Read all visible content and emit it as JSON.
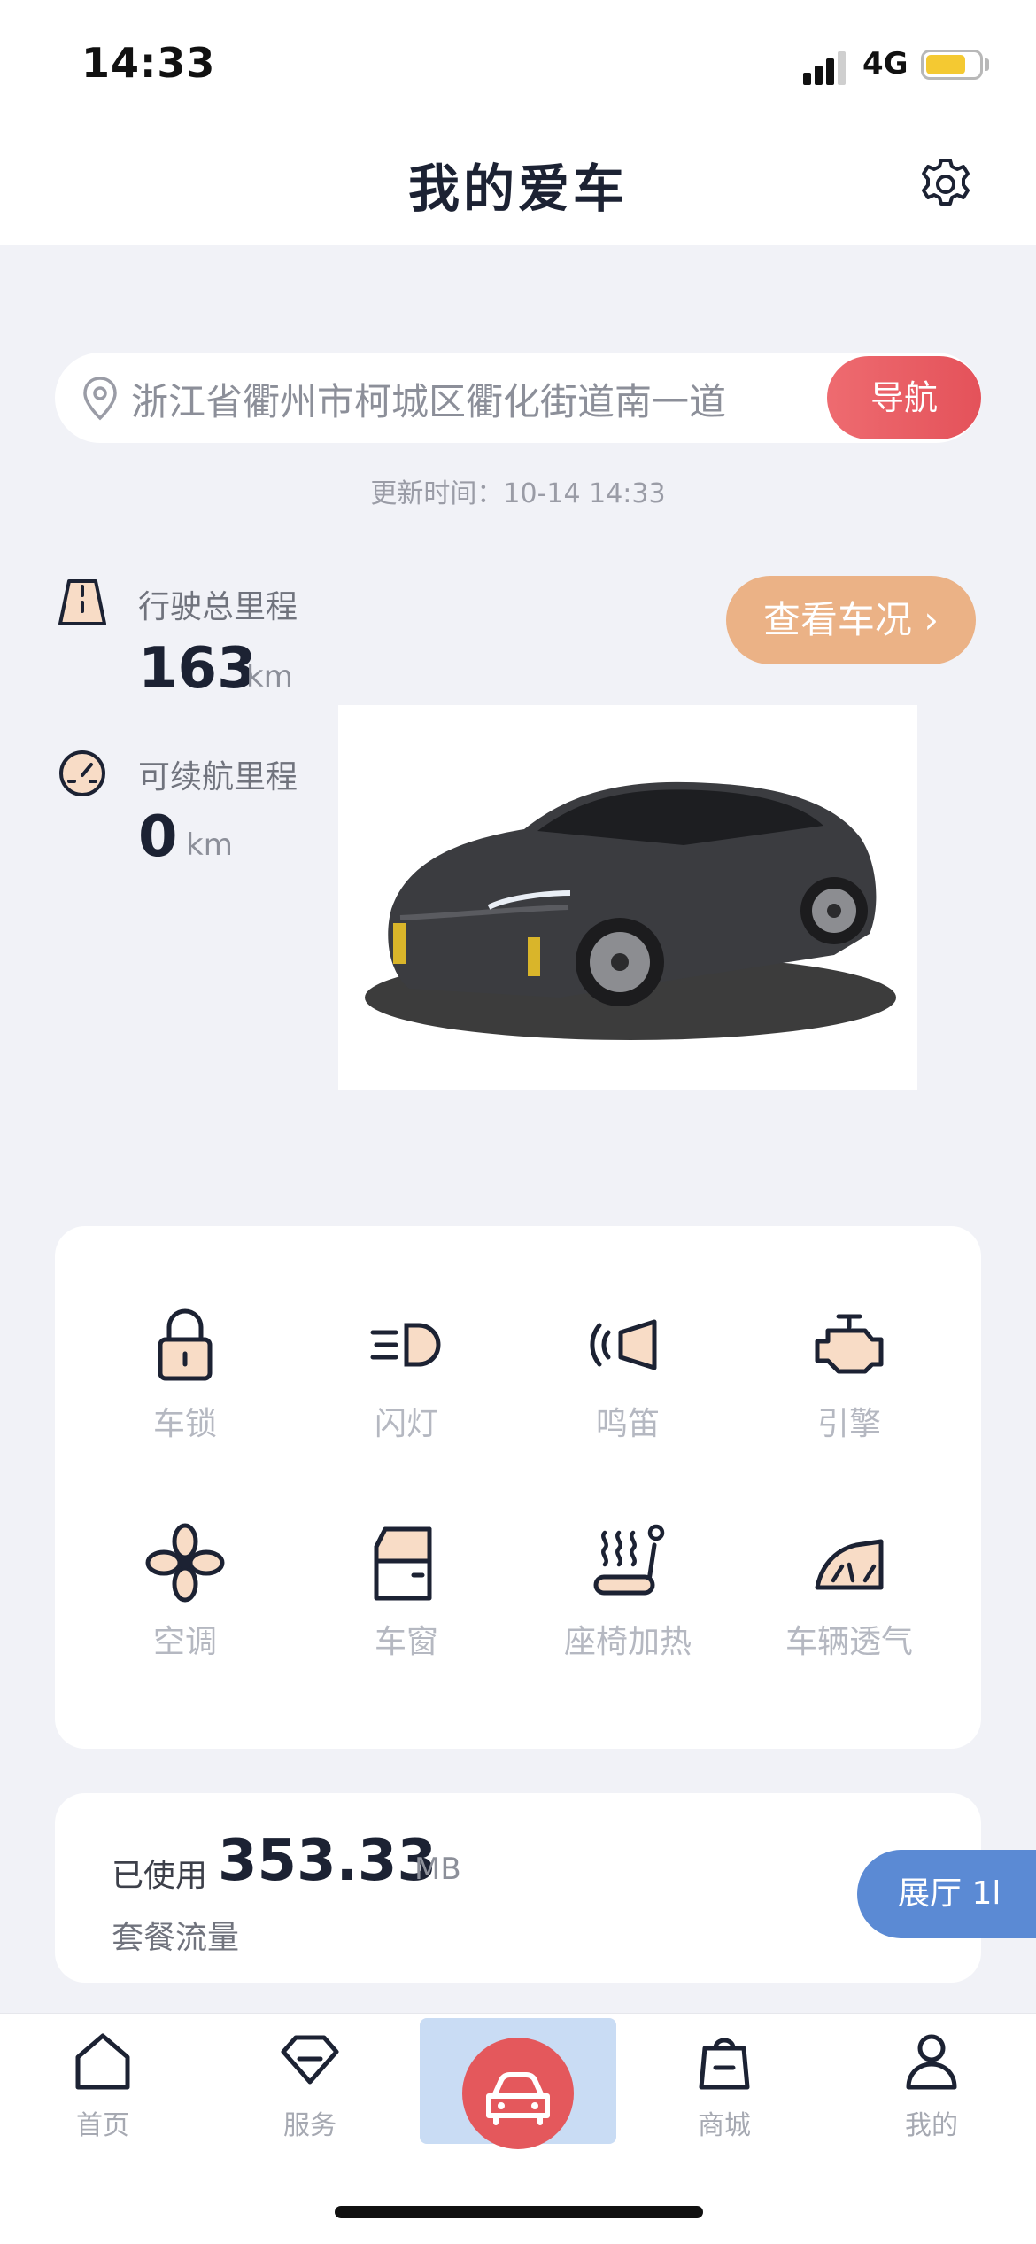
{
  "status_bar": {
    "time": "14:33",
    "network": "4G"
  },
  "header": {
    "title": "我的爱车",
    "settings_icon": "gear-icon"
  },
  "location": {
    "address": "浙江省衢州市柯城区衢化街道南一道",
    "nav_button": "导航",
    "updated": "更新时间：10-14 14:33"
  },
  "stats": {
    "total_label": "行驶总里程",
    "total_value": "163",
    "total_unit": "km",
    "range_label": "可续航里程",
    "range_value": "0",
    "range_unit": "km",
    "status_button": "查看车况 ›"
  },
  "controls": [
    {
      "label": "车锁",
      "icon": "lock-icon"
    },
    {
      "label": "闪灯",
      "icon": "headlight-icon"
    },
    {
      "label": "鸣笛",
      "icon": "horn-icon"
    },
    {
      "label": "引擎",
      "icon": "engine-icon"
    },
    {
      "label": "空调",
      "icon": "fan-icon"
    },
    {
      "label": "车窗",
      "icon": "window-icon"
    },
    {
      "label": "座椅加热",
      "icon": "seat-heat-icon"
    },
    {
      "label": "车辆透气",
      "icon": "vent-icon"
    }
  ],
  "data_usage": {
    "used_label": "已使用",
    "value": "353.33",
    "unit": "MB",
    "caption": "套餐流量",
    "showroom_button": "展厅 1l"
  },
  "tabs": [
    {
      "label": "首页",
      "icon": "home-icon"
    },
    {
      "label": "服务",
      "icon": "diamond-icon"
    },
    {
      "label": "",
      "icon": "car-icon"
    },
    {
      "label": "商城",
      "icon": "bag-icon"
    },
    {
      "label": "我的",
      "icon": "user-icon"
    }
  ],
  "colors": {
    "accent_red": "#e4525a",
    "accent_orange": "#ebb286",
    "accent_blue": "#5b8ad4",
    "icon_fill": "#f8dcc6"
  }
}
